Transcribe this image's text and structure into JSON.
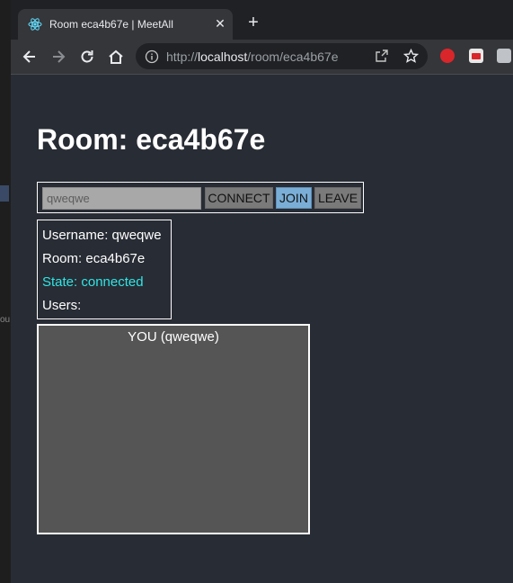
{
  "browser": {
    "tab_title": "Room eca4b67e | MeetAll",
    "new_tab_label": "+",
    "close_label": "✕",
    "url_scheme": "http://",
    "url_host": "localhost",
    "url_path": "/room/eca4b67e"
  },
  "desktop": {
    "edge_text": "ou"
  },
  "page": {
    "title": "Room: eca4b67e",
    "controls": {
      "username_value": "qweqwe",
      "connect_label": "CONNECT",
      "join_label": "JOIN",
      "leave_label": "LEAVE"
    },
    "info": {
      "username": "Username: qweqwe",
      "room": "Room: eca4b67e",
      "state": "State: connected",
      "users": "Users:"
    },
    "video": {
      "label": "YOU (qweqwe)"
    }
  },
  "colors": {
    "page_bg": "#282c34",
    "state_color": "#2ee6e6",
    "join_button": "#7aaed6",
    "video_bg": "#555555"
  }
}
